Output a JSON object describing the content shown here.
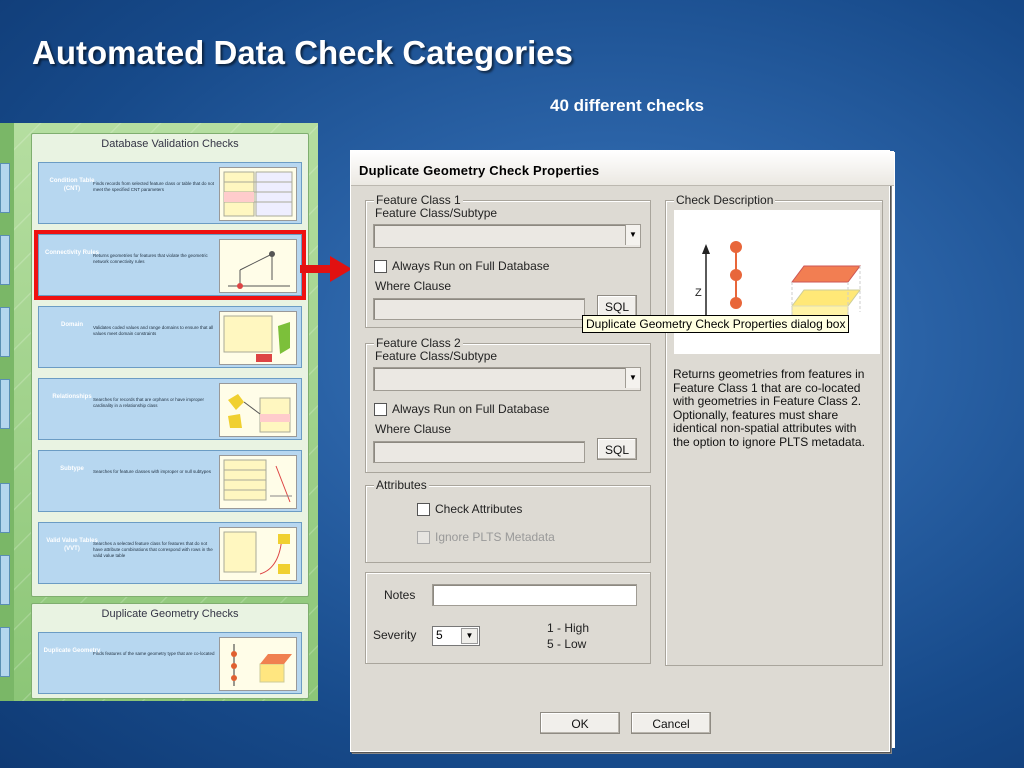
{
  "slide": {
    "title": "Automated Data Check Categories",
    "subtitle": "40 different checks"
  },
  "poster": {
    "database_panel_title": "Database Validation Checks",
    "duplicate_panel_title": "Duplicate Geometry Checks",
    "cards": [
      {
        "name": "Condition Table (CNT)",
        "desc": "Finds records from selected feature class or table that do not meet the specified CNT parameters"
      },
      {
        "name": "Connectivity Rules",
        "desc": "Returns geometries for features that violate the geometric network connectivity rules",
        "highlighted": true
      },
      {
        "name": "Domain",
        "desc": "Validates coded values and range domains to ensure that all values meet domain constraints"
      },
      {
        "name": "Relationships",
        "desc": "Searches for records that are orphans or have improper cardinality in a relationship class"
      },
      {
        "name": "Subtype",
        "desc": "Searches for feature classes with improper or null subtypes"
      },
      {
        "name": "Valid Value Tables (VVT)",
        "desc": "Searches a selected feature class for features that do not have attribute combinations that correspond with rows in the valid value table"
      },
      {
        "name": "Duplicate Geometry",
        "desc": "Finds features of the same geometry type that are co-located"
      }
    ],
    "highlight_color": "#e11111"
  },
  "dialog": {
    "title": "Duplicate Geometry Check Properties",
    "fc1": {
      "legend": "Feature Class 1",
      "subtype_label": "Feature Class/Subtype",
      "always_run_label": "Always Run on Full Database",
      "where_label": "Where Clause",
      "sql_label": "SQL"
    },
    "fc2": {
      "legend": "Feature Class 2",
      "subtype_label": "Feature Class/Subtype",
      "always_run_label": "Always Run on Full Database",
      "where_label": "Where Clause",
      "sql_label": "SQL"
    },
    "attributes": {
      "legend": "Attributes",
      "check_attributes_label": "Check Attributes",
      "ignore_plts_label": "Ignore PLTS Metadata"
    },
    "notes_label": "Notes",
    "severity_label": "Severity",
    "severity_value": "5",
    "severity_high": "1 - High",
    "severity_low": "5 - Low",
    "check_description": {
      "legend": "Check Description",
      "axis_label": "Z",
      "text": "Returns geometries from features in Feature Class 1 that are co-located with geometries in Feature Class 2. Optionally, features must share identical non-spatial attributes with the option to ignore PLTS metadata."
    },
    "tooltip": "Duplicate Geometry Check Properties dialog box",
    "ok_label": "OK",
    "cancel_label": "Cancel"
  }
}
